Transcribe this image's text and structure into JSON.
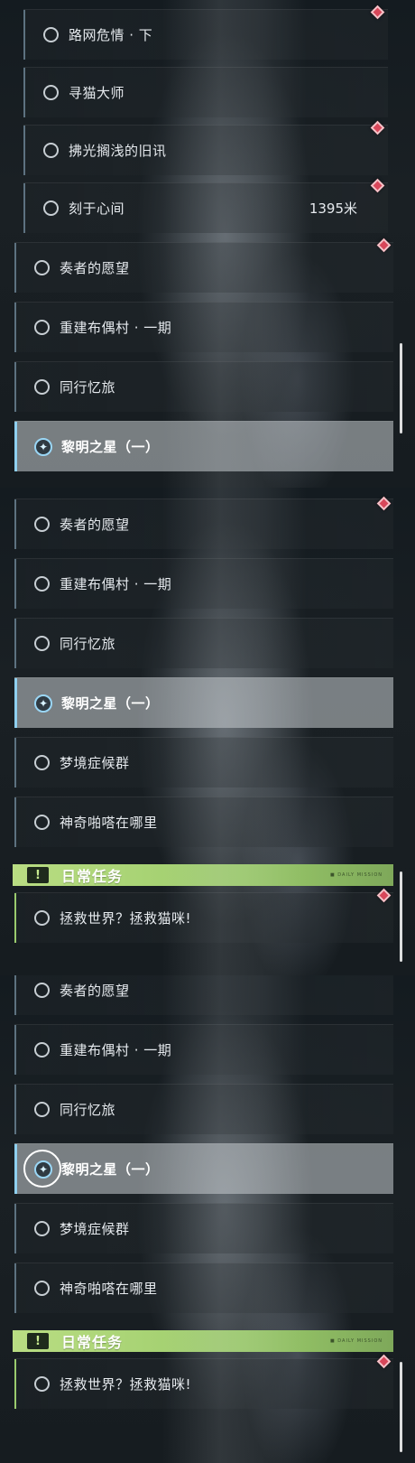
{
  "frame1": {
    "sub_quests": [
      {
        "label": "路网危情 · 下",
        "distance": ""
      },
      {
        "label": "寻猫大师",
        "distance": ""
      },
      {
        "label": "拂光搁浅的旧讯",
        "distance": ""
      },
      {
        "label": "刻于心间",
        "distance": "1395米"
      }
    ],
    "main_quests": [
      {
        "label": "奏者的愿望"
      },
      {
        "label": "重建布偶村 · 一期"
      },
      {
        "label": "同行忆旅"
      },
      {
        "label": "黎明之星（一）"
      }
    ]
  },
  "frame2": {
    "main_quests": [
      {
        "label": "奏者的愿望"
      },
      {
        "label": "重建布偶村 · 一期"
      },
      {
        "label": "同行忆旅"
      },
      {
        "label": "黎明之星（一）"
      },
      {
        "label": "梦境症候群"
      },
      {
        "label": "神奇啪嗒在哪里"
      }
    ],
    "section": {
      "title": "日常任务",
      "icon": "!",
      "tag": "■ DAILY MISSION"
    },
    "daily": [
      {
        "label": "拯救世界？拯救猫咪!"
      }
    ]
  },
  "frame3": {
    "main_quests": [
      {
        "label": "奏者的愿望"
      },
      {
        "label": "重建布偶村 · 一期"
      },
      {
        "label": "同行忆旅"
      },
      {
        "label": "黎明之星（一）"
      },
      {
        "label": "梦境症候群"
      },
      {
        "label": "神奇啪嗒在哪里"
      }
    ],
    "section": {
      "title": "日常任务",
      "icon": "!",
      "tag": "■ DAILY MISSION"
    },
    "daily": [
      {
        "label": "拯救世界？拯救猫咪!"
      }
    ]
  },
  "icons": {
    "star": "✦"
  },
  "colors": {
    "accent_active": "#8fd0f0",
    "pin": "#d8475a",
    "daily_header": "#b9dd83"
  }
}
